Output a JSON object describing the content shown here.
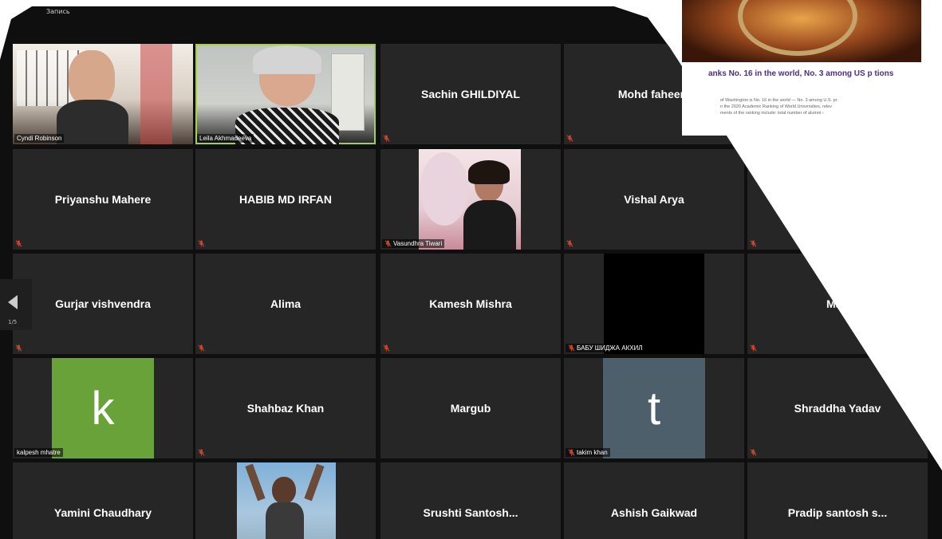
{
  "recording_label": "Запись",
  "pager": {
    "count": "1/5"
  },
  "shared_screen": {
    "headline": "anks No. 16 in the world, No. 3 among US p tions",
    "body_lines": [
      "of Washington is No. 16 in the world — No. 3 among U.S. pr",
      "n the 2020 Academic Ranking of World Universities, relev",
      "ments of the ranking include: total number of alumni ›"
    ]
  },
  "colors": {
    "background": "#0f0f0f",
    "tile": "#262626",
    "active_border": "#a7cf3f",
    "mic_muted": "#d4452b"
  },
  "participants": [
    {
      "name": "Cyndi Robinson",
      "display": "video",
      "icon": "muted-mic-icon"
    },
    {
      "name": "Leila Akhmadeeva",
      "display": "video",
      "active": true
    },
    {
      "name": "Sachin GHILDIYAL",
      "display": "name",
      "icon": "muted-mic-icon"
    },
    {
      "name": "Mohd faheem",
      "display": "name",
      "icon": "muted-mic-icon"
    },
    {
      "name": "Priyanshu Mahere",
      "display": "name",
      "icon": "muted-mic-icon"
    },
    {
      "name": "HABIB MD IRFAN",
      "display": "name",
      "icon": "muted-mic-icon"
    },
    {
      "name": "Vasundhra Tiwari",
      "display": "video",
      "icon": "muted-mic-icon"
    },
    {
      "name": "Vishal Arya",
      "display": "name",
      "icon": "muted-mic-icon"
    },
    {
      "name": "Gurjar vishvendra",
      "display": "name",
      "icon": "muted-mic-icon"
    },
    {
      "name": "Alima",
      "display": "name",
      "icon": "muted-mic-icon"
    },
    {
      "name": "Kamesh Mishra",
      "display": "name",
      "icon": "muted-mic-icon"
    },
    {
      "name": "БАБУ ШИДЖА АКХИЛ",
      "display": "video",
      "icon": "muted-mic-icon"
    },
    {
      "name": "Man",
      "display": "name",
      "icon": "muted-mic-icon"
    },
    {
      "name": "kalpesh mhatre",
      "display": "avatar",
      "initial": "k",
      "avatar_color": "#6aa23a"
    },
    {
      "name": "Shahbaz Khan",
      "display": "name",
      "icon": "muted-mic-icon"
    },
    {
      "name": "Margub",
      "display": "name"
    },
    {
      "name": "takim khan",
      "display": "avatar",
      "initial": "t",
      "avatar_color": "#4d5f6b",
      "icon": "muted-mic-icon"
    },
    {
      "name": "Shraddha Yadav",
      "display": "name",
      "icon": "muted-mic-icon"
    },
    {
      "name": "Yamini Chaudhary",
      "display": "name"
    },
    {
      "name": "Srushti Santosh...",
      "display": "name"
    },
    {
      "name": "Ashish Gaikwad",
      "display": "name"
    },
    {
      "name": "Pradip santosh s...",
      "display": "name"
    }
  ]
}
